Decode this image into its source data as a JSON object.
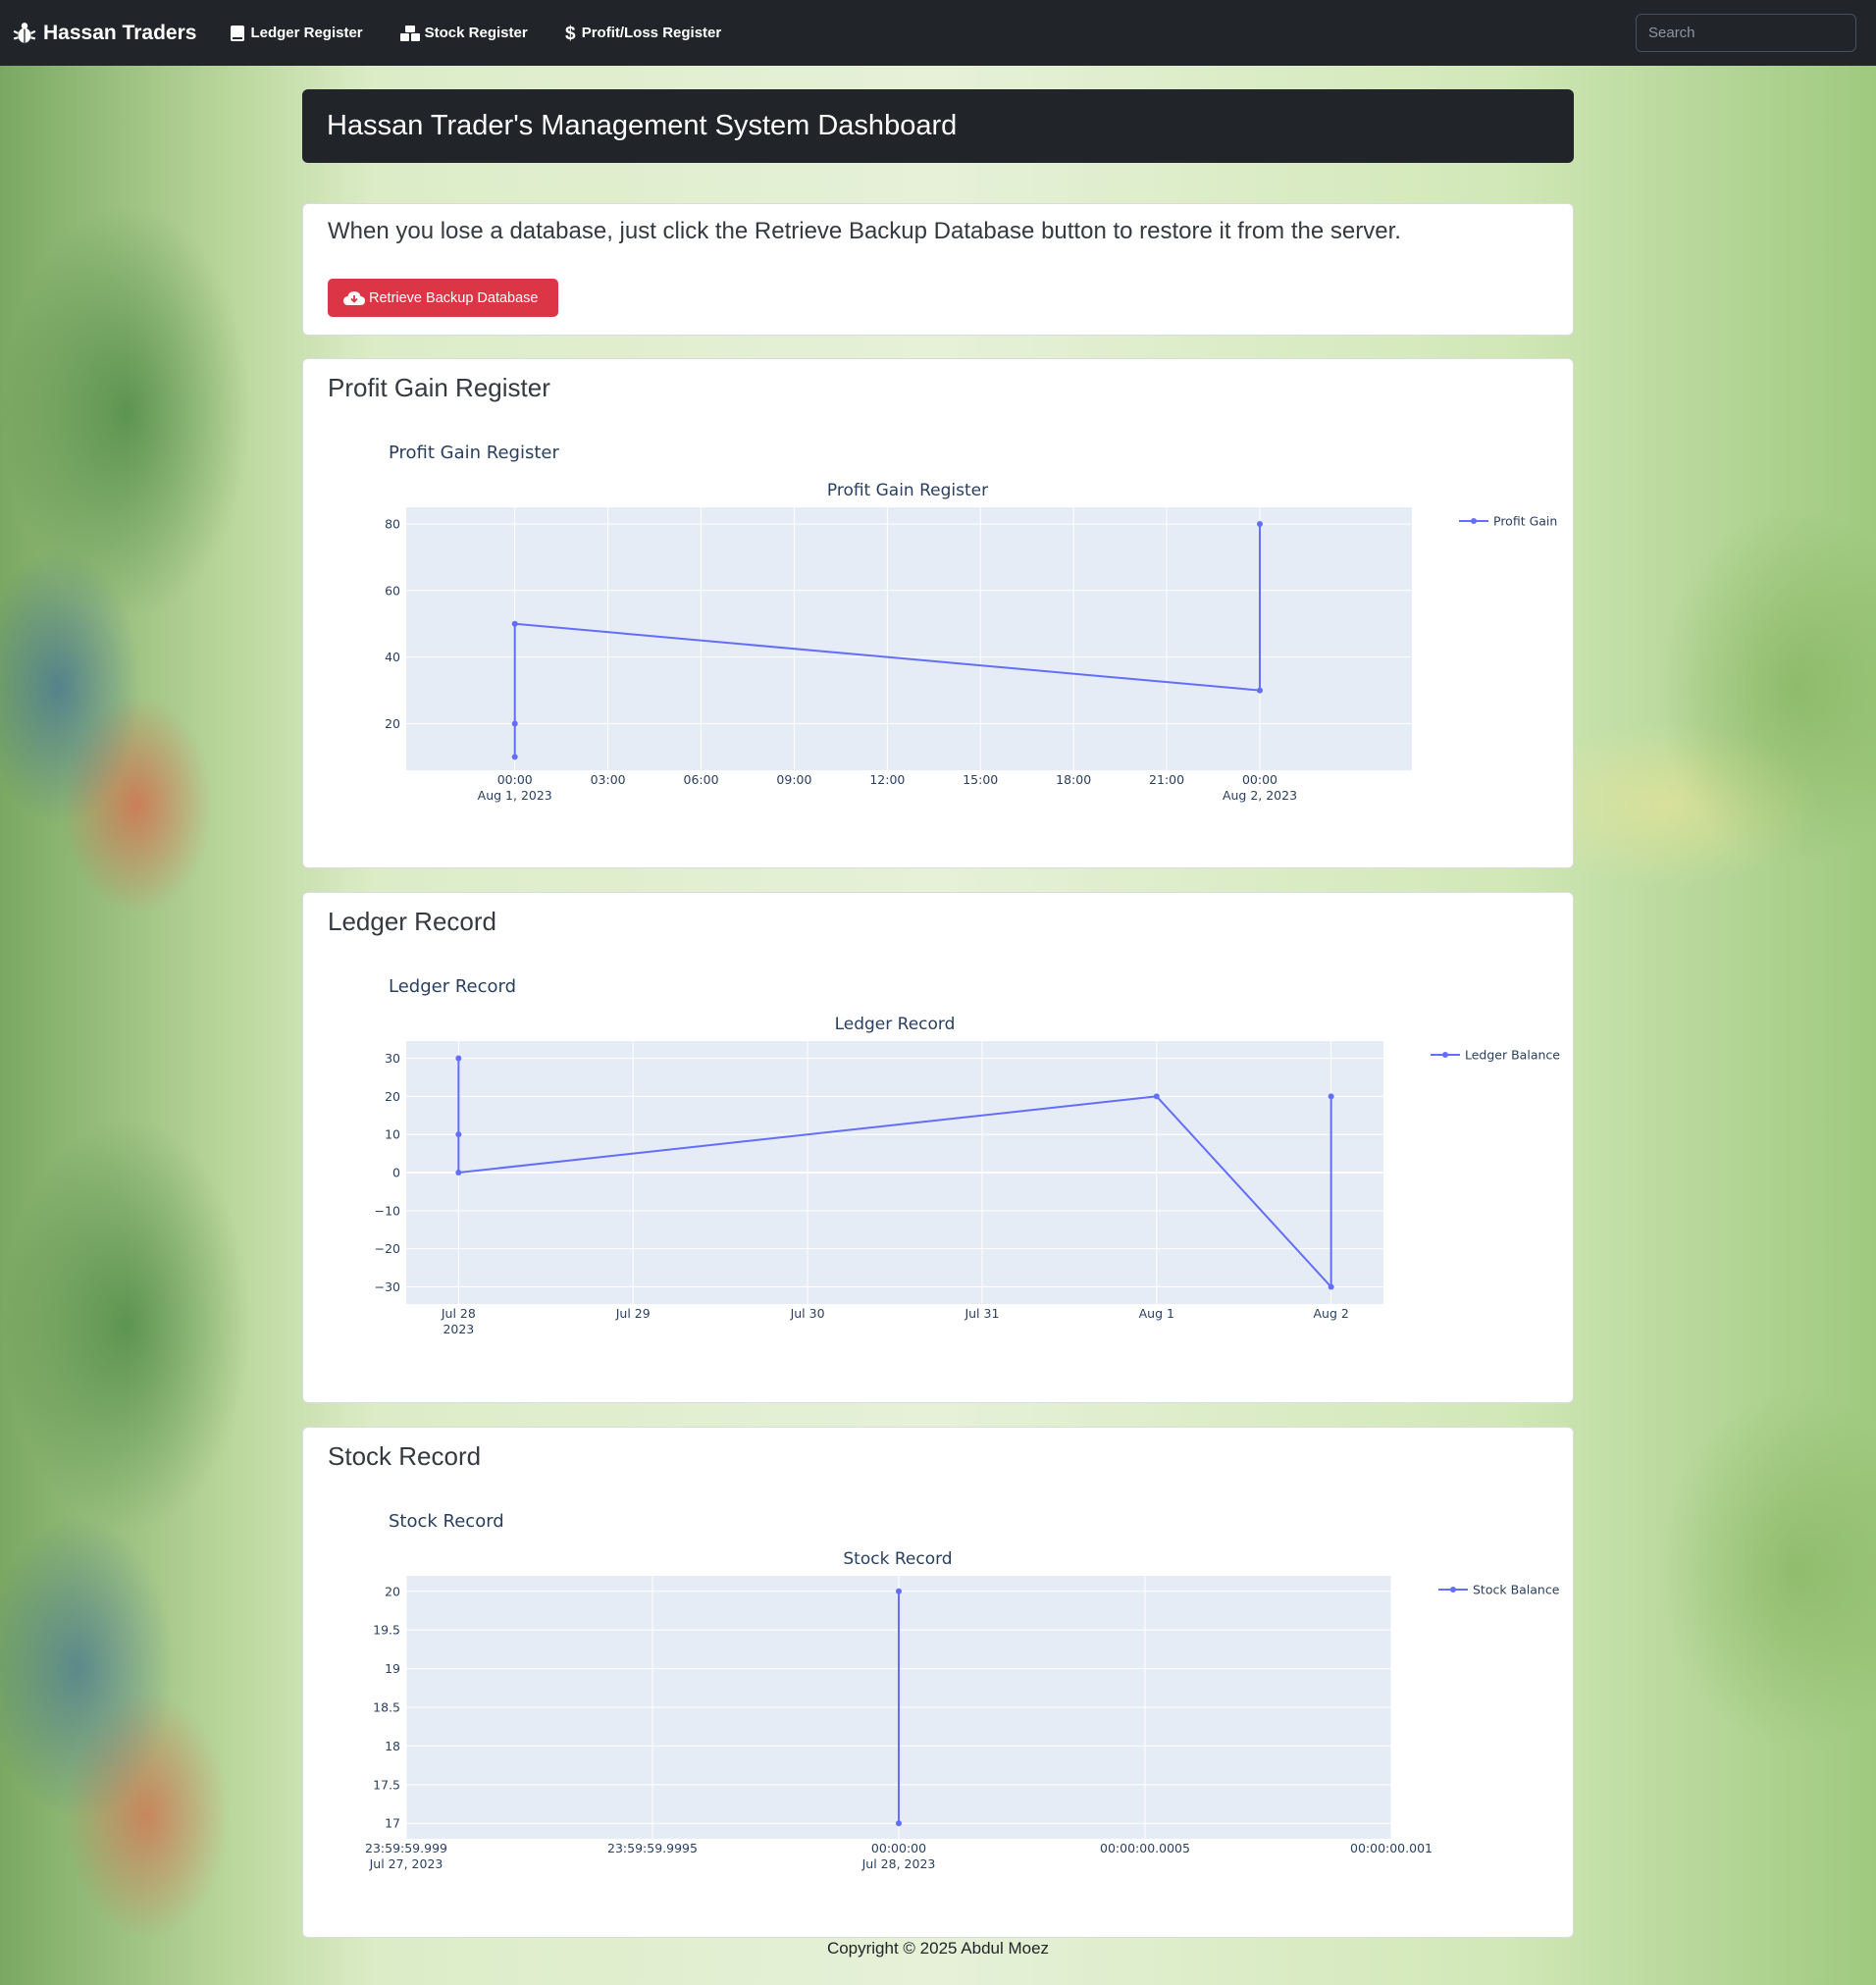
{
  "nav": {
    "brand": "Hassan Traders",
    "links": [
      "Ledger Register",
      "Stock Register",
      "Profit/Loss Register"
    ],
    "search_placeholder": "Search"
  },
  "header": {
    "title": "Hassan Trader's Management System Dashboard"
  },
  "backup": {
    "notice": "When you lose a database, just click the Retrieve Backup Database button to restore it from the server.",
    "button_label": "Retrieve Backup Database"
  },
  "footer": {
    "text": "Copyright © 2025 Abdul Moez"
  },
  "colors": {
    "series": "#636efa",
    "plot_bg": "#e5ecf6",
    "danger": "#dc3545",
    "dark": "#212529"
  },
  "chart_data": [
    {
      "type": "line",
      "card_title": "Profit Gain Register",
      "subtitle": "Profit Gain Register",
      "title": "Profit Gain Register",
      "series": [
        {
          "name": "Profit Gain",
          "x": [
            "2023-08-01 00:00",
            "2023-08-01 00:00",
            "2023-08-01 00:00",
            "2023-08-02 00:00",
            "2023-08-02 00:00"
          ],
          "y": [
            10,
            20,
            50,
            30,
            80
          ]
        }
      ],
      "x_tick_labels": [
        "00:00\nAug 1, 2023",
        "03:00",
        "06:00",
        "09:00",
        "12:00",
        "15:00",
        "18:00",
        "21:00",
        "00:00\nAug 2, 2023"
      ],
      "y_ticks": [
        20,
        40,
        60,
        80
      ],
      "ylim": [
        6,
        85
      ],
      "legend": "top-right",
      "grid": true
    },
    {
      "type": "line",
      "card_title": "Ledger Record",
      "subtitle": "Ledger Record",
      "title": "Ledger Record",
      "series": [
        {
          "name": "Ledger Balance",
          "x": [
            "2023-07-28",
            "2023-07-28",
            "2023-07-28",
            "2023-08-01",
            "2023-08-02",
            "2023-08-02"
          ],
          "y": [
            30,
            10,
            0,
            20,
            -30,
            20
          ]
        }
      ],
      "x_tick_labels": [
        "Jul 28\n2023",
        "Jul 29",
        "Jul 30",
        "Jul 31",
        "Aug 1",
        "Aug 2"
      ],
      "y_ticks": [
        30,
        20,
        10,
        0,
        -10,
        -20,
        -30
      ],
      "ylim": [
        -34.5,
        34.5
      ],
      "legend": "top-right",
      "grid": true
    },
    {
      "type": "line",
      "card_title": "Stock Record",
      "subtitle": "Stock Record",
      "title": "Stock Record",
      "series": [
        {
          "name": "Stock Balance",
          "x": [
            "2023-07-28 00:00:00",
            "2023-07-28 00:00:00"
          ],
          "y": [
            20,
            17
          ]
        }
      ],
      "x_tick_labels": [
        "23:59:59.999\nJul 27, 2023",
        "23:59:59.9995",
        "00:00:00\nJul 28, 2023",
        "00:00:00.0005",
        "00:00:00.001"
      ],
      "y_ticks": [
        20,
        19.5,
        19,
        18.5,
        18,
        17.5,
        17
      ],
      "ylim": [
        16.8,
        20.2
      ],
      "legend": "top-right",
      "grid": true
    }
  ]
}
